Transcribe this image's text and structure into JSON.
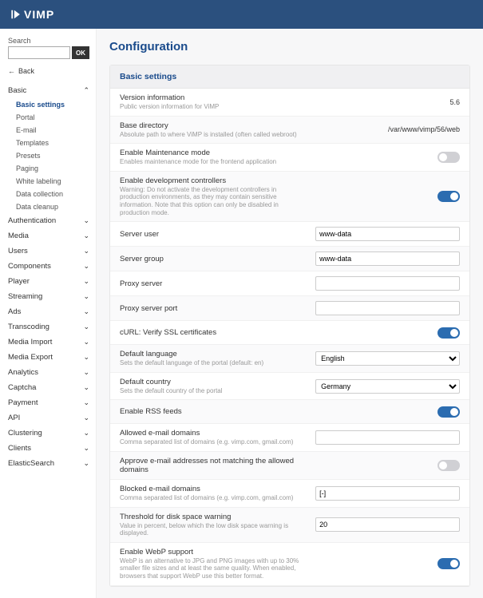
{
  "brand": "VIMP",
  "search": {
    "label": "Search",
    "ok": "OK",
    "value": ""
  },
  "back": "Back",
  "nav": {
    "basic": {
      "label": "Basic",
      "expanded": true,
      "items": [
        {
          "label": "Basic settings",
          "active": true
        },
        {
          "label": "Portal"
        },
        {
          "label": "E-mail"
        },
        {
          "label": "Templates"
        },
        {
          "label": "Presets"
        },
        {
          "label": "Paging"
        },
        {
          "label": "White labeling"
        },
        {
          "label": "Data collection"
        },
        {
          "label": "Data cleanup"
        }
      ]
    },
    "sections": [
      "Authentication",
      "Media",
      "Users",
      "Components",
      "Player",
      "Streaming",
      "Ads",
      "Transcoding",
      "Media Import",
      "Media Export",
      "Analytics",
      "Captcha",
      "Payment",
      "API",
      "Clustering",
      "Clients",
      "ElasticSearch"
    ]
  },
  "page": {
    "title": "Configuration",
    "panel": "Basic settings"
  },
  "rows": [
    {
      "t": "Version information",
      "d": "Public version information for ViMP",
      "type": "static",
      "v": "5.6"
    },
    {
      "t": "Base directory",
      "d": "Absolute path to where ViMP is installed (often called webroot)",
      "type": "static",
      "v": "/var/www/vimp/56/web"
    },
    {
      "t": "Enable Maintenance mode",
      "d": "Enables maintenance mode for the frontend application",
      "type": "toggle",
      "v": false
    },
    {
      "t": "Enable development controllers",
      "d": "Warning: Do not activate the development controllers in production environments, as they may contain sensitive information. Note that this option can only be disabled in production mode.",
      "type": "toggle",
      "v": true
    },
    {
      "t": "Server user",
      "type": "text",
      "v": "www-data"
    },
    {
      "t": "Server group",
      "type": "text",
      "v": "www-data"
    },
    {
      "t": "Proxy server",
      "type": "text",
      "v": ""
    },
    {
      "t": "Proxy server port",
      "type": "text",
      "v": ""
    },
    {
      "t": "cURL: Verify SSL certificates",
      "type": "toggle",
      "v": true
    },
    {
      "t": "Default language",
      "d": "Sets the default language of the portal (default: en)",
      "type": "select",
      "v": "English"
    },
    {
      "t": "Default country",
      "d": "Sets the default country of the portal",
      "type": "select",
      "v": "Germany"
    },
    {
      "t": "Enable RSS feeds",
      "type": "toggle",
      "v": true
    },
    {
      "t": "Allowed e-mail domains",
      "d": "Comma separated list of domains (e.g. vimp.com, gmail.com)",
      "type": "text",
      "v": ""
    },
    {
      "t": "Approve e-mail addresses not matching the allowed domains",
      "type": "toggle",
      "v": false
    },
    {
      "t": "Blocked e-mail domains",
      "d": "Comma separated list of domains (e.g. vimp.com, gmail.com)",
      "type": "text",
      "v": "[-]"
    },
    {
      "t": "Threshold for disk space warning",
      "d": "Value in percent, below which the low disk space warning is displayed.",
      "type": "text",
      "v": "20"
    },
    {
      "t": "Enable WebP support",
      "d": "WebP is an alternative to JPG and PNG images with up to 30% smaller file sizes and at least the same quality. When enabled, browsers that support WebP use this better format.",
      "type": "toggle",
      "v": true
    }
  ]
}
